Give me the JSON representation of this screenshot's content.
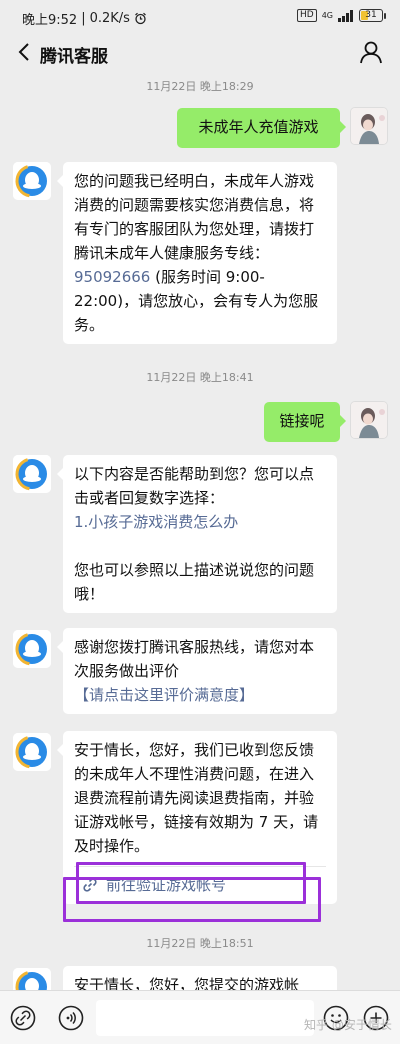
{
  "status_bar": {
    "time": "晚上9:52",
    "speed": "0.2K/s",
    "hd": "HD",
    "network": "4G",
    "battery": "31"
  },
  "header": {
    "title": "腾讯客服"
  },
  "messages": {
    "ts1": "11月22日 晚上18:29",
    "user1": "未成年人充值游戏",
    "bot1": {
      "p1": "您的问题我已经明白，未成年人游戏消费的问题需要核实您消费信息，将有专门的客服团队为您处理，请拨打腾讯未成年人健康服务专线：",
      "phone": "95092666",
      "p2": " (服务时间 9:00-22:00)，请您放心，会有专人为您服务。"
    },
    "ts2": "11月22日 晚上18:41",
    "user2": "链接呢",
    "bot2": {
      "p1": "以下内容是否能帮助到您？您可以点击或者回复数字选择：",
      "option1": "1.小孩子游戏消费怎么办",
      "p2": "您也可以参照以上描述说说您的问题哦！"
    },
    "bot3": {
      "p1": "感谢您拨打腾讯客服热线，请您对本次服务做出评价",
      "link": "【请点击这里评价满意度】"
    },
    "bot4": {
      "p1": "安于情长，您好，我们已收到您反馈的未成年人不理性消费问题，在进入退费流程前请先阅读退费指南，并验证游戏帐号，链接有效期为 7 天，请及时操作。",
      "link": "前往验证游戏帐号"
    },
    "ts3": "11月22日 晚上18:51",
    "bot5_partial": "安于情长，您好，您提交的游戏帐"
  },
  "watermark": "知乎 @安于情长",
  "colors": {
    "background": "#ededed",
    "user_bubble": "#95ec69",
    "bot_bubble": "#ffffff",
    "link": "#576b95",
    "highlight": "#9b30d9"
  },
  "icons": {
    "back": "chevron-left-icon",
    "user": "person-icon",
    "link": "link-icon",
    "voice": "voice-icon",
    "emoji": "emoji-icon",
    "plus": "plus-icon"
  }
}
